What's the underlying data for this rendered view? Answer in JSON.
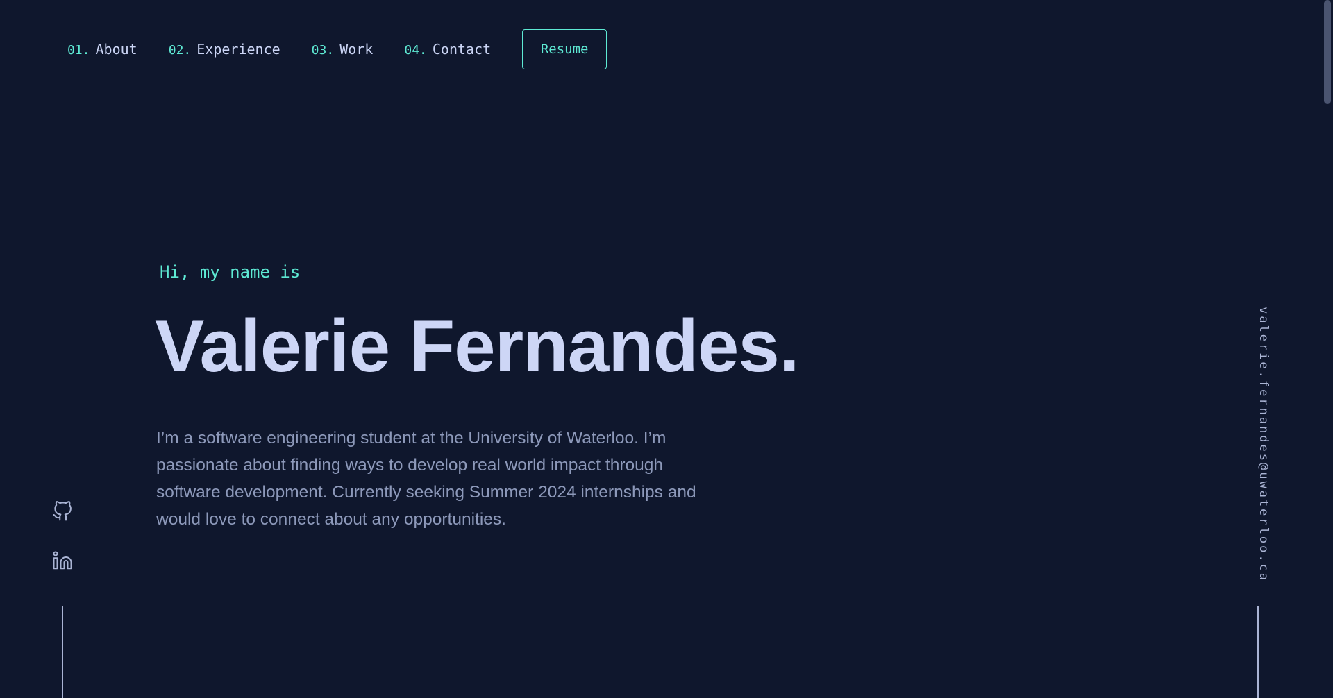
{
  "nav": {
    "items": [
      {
        "num": "01.",
        "label": "About"
      },
      {
        "num": "02.",
        "label": "Experience"
      },
      {
        "num": "03.",
        "label": "Work"
      },
      {
        "num": "04.",
        "label": "Contact"
      }
    ],
    "resume_label": "Resume"
  },
  "hero": {
    "greeting": "Hi, my name is",
    "name": "Valerie Fernandes.",
    "bio": "I’m a software engineering student at the University of Waterloo. I’m passionate about finding ways to develop real world impact through software development. Currently seeking Summer 2024 internships and would love to connect about any opportunities."
  },
  "sidebar": {
    "email": "valerie.fernandes@uwaterloo.ca",
    "social_icons": [
      "github-icon",
      "linkedin-icon"
    ]
  },
  "colors": {
    "background": "#0f172d",
    "accent": "#5eead4",
    "heading": "#cdd6f6",
    "text": "#8d99ba",
    "nav_text": "#cbd5f5"
  }
}
